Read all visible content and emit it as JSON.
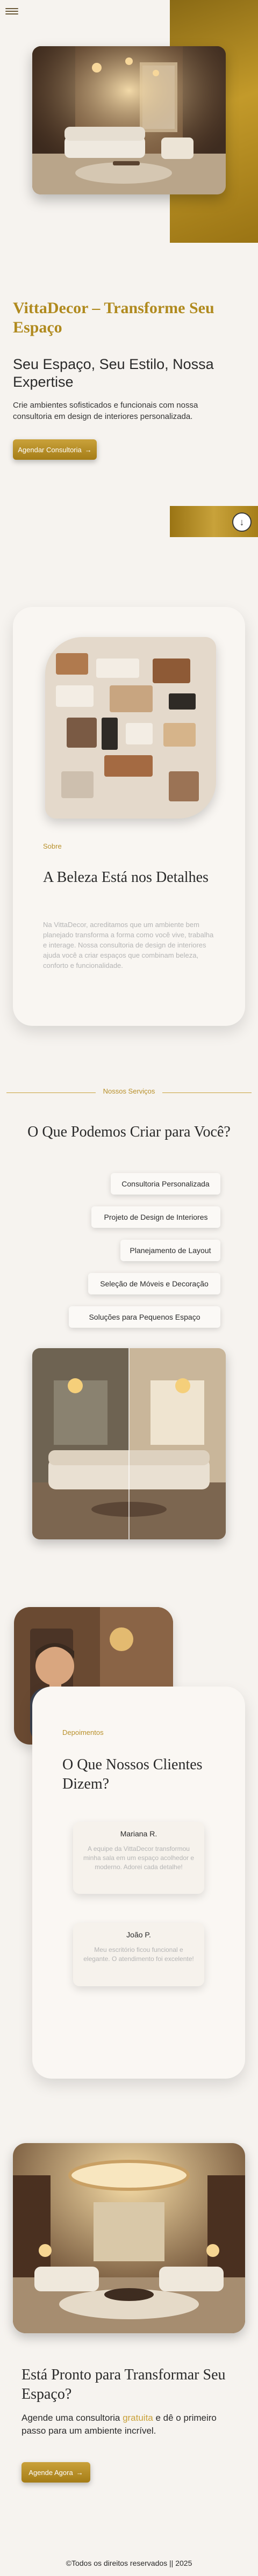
{
  "header": {
    "menu_icon": "hamburger-menu-icon"
  },
  "hero": {
    "title": "VittaDecor – Transforme Seu Espaço",
    "subtitle": "Seu Espaço, Seu Estilo, Nossa Expertise",
    "description": "Crie ambientes sofisticados e funcionais com nossa consultoria em design de interiores personalizada.",
    "cta_label": "Agendar Consultoria",
    "scroll_icon": "arrow-down-icon"
  },
  "about": {
    "label": "Sobre",
    "title": "A Beleza Está nos Detalhes",
    "text": "Na VittaDecor, acreditamos que um ambiente bem planejado transforma a forma como você vive, trabalha e interage. Nossa consultoria de design de interiores ajuda você a criar espaços que combinam beleza, conforto e funcionalidade."
  },
  "services": {
    "label": "Nossos Serviços",
    "title": "O Que Podemos Criar para Você?",
    "items": [
      "Consultoria Personalizada",
      "Projeto de Design de Interiores",
      "Planejamento de Layout",
      "Seleção de Móveis e Decoração",
      "Soluções para Pequenos Espaço"
    ]
  },
  "testimonials": {
    "label": "Depoimentos",
    "title": "O Que Nossos Clientes Dizem?",
    "items": [
      {
        "name": "Mariana R.",
        "quote": "A equipe da VittaDecor transformou minha sala em um espaço acolhedor e moderno. Adorei cada detalhe!"
      },
      {
        "name": "João P.",
        "quote": "Meu escritório ficou funcional e elegante. O atendimento foi excelente!"
      }
    ]
  },
  "cta": {
    "title": "Está Pronto para Transformar Seu Espaço?",
    "desc_before": "Agende uma consultoria ",
    "desc_accent": "gratuita",
    "desc_after": " e dê o primeiro passo para um ambiente incrível.",
    "button_label": "Agende Agora"
  },
  "footer": {
    "text": "©Todos os direitos reservados || 2025"
  },
  "colors": {
    "accent": "#c9a13a",
    "gold_dark": "#9a7414",
    "background": "#f6f3ef"
  }
}
